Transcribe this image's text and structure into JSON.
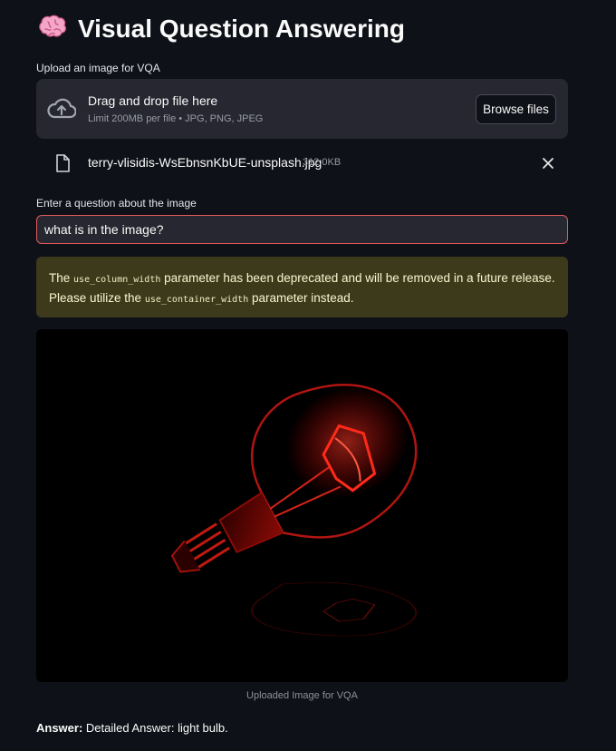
{
  "app": {
    "title": "Visual Question Answering",
    "title_icon": "brain-emoji"
  },
  "uploader": {
    "label": "Upload an image for VQA",
    "drag_text": "Drag and drop file here",
    "limit_text": "Limit 200MB per file • JPG, PNG, JPEG",
    "browse_label": "Browse files",
    "icon": "cloud-upload-icon"
  },
  "uploaded_file": {
    "name": "terry-vlisidis-WsEbnsnKbUE-unsplash.jpg",
    "size": "312.0KB",
    "icon": "file-icon",
    "remove_icon": "close-icon"
  },
  "question": {
    "label": "Enter a question about the image",
    "value": "what is in the image?"
  },
  "warning": {
    "part1": "The",
    "code1": "use_column_width",
    "part2": "parameter has been deprecated and will be removed in a future release. Please utilize the",
    "code2": "use_container_width",
    "part3": "parameter instead."
  },
  "image": {
    "caption": "Uploaded Image for VQA",
    "subject": "red glowing light bulb on black background"
  },
  "answer": {
    "label": "Answer:",
    "text": "Detailed Answer: light bulb."
  },
  "colors": {
    "background": "#0e1117",
    "surface": "#262730",
    "input_focus_border": "#e05a5a",
    "warning_bg": "#3d3a1c",
    "bulb_red": "#ff2a1a"
  }
}
